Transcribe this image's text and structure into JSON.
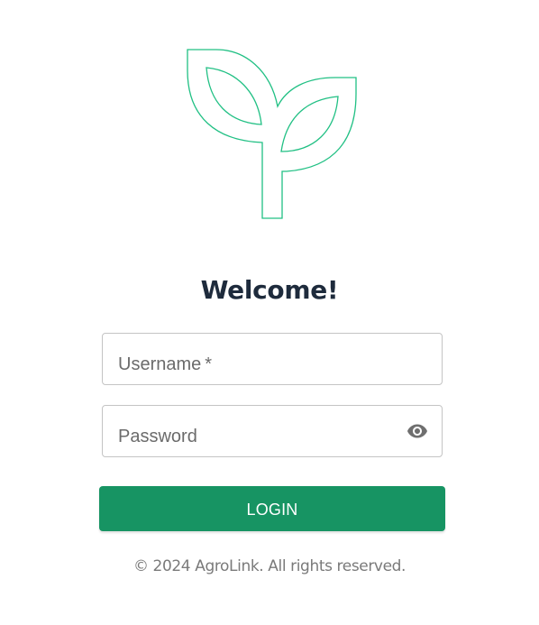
{
  "brand": {
    "logo_icon": "sprout-icon",
    "logo_color": "#21c084"
  },
  "login": {
    "title": "Welcome!",
    "username": {
      "placeholder": "Username",
      "required_marker": "*",
      "value": ""
    },
    "password": {
      "placeholder": "Password",
      "value": "",
      "toggle_icon": "eye-icon"
    },
    "submit_label": "LOGIN",
    "submit_color": "#179463"
  },
  "footer": {
    "copyright": "© 2024 AgroLink. All rights reserved."
  }
}
